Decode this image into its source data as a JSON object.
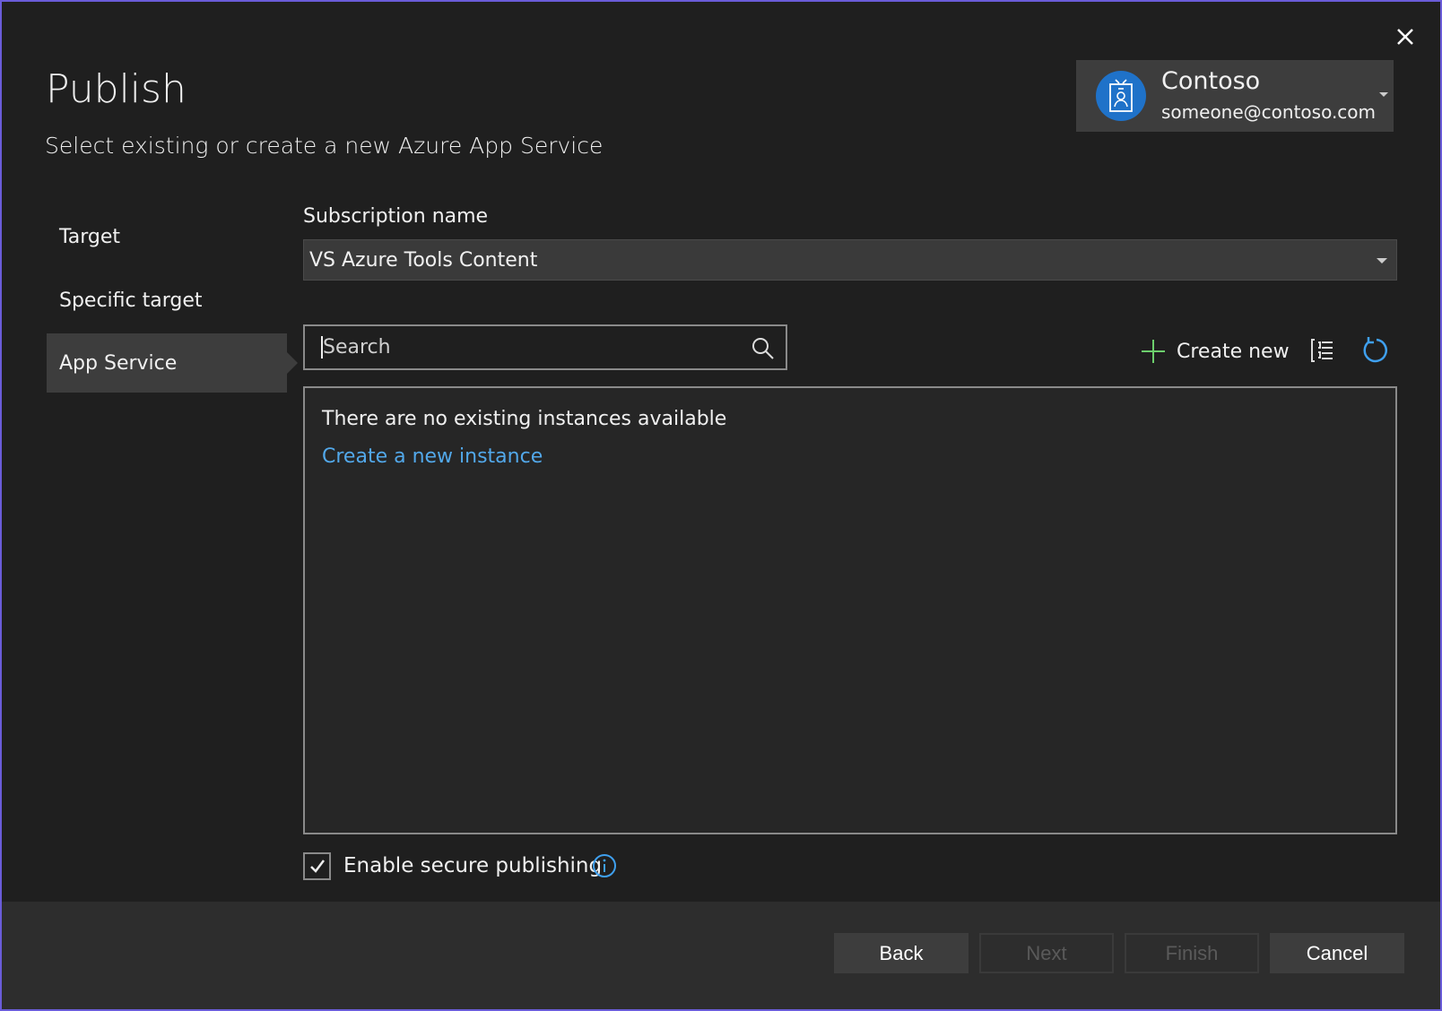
{
  "dialog": {
    "title": "Publish",
    "subtitle": "Select existing or create a new Azure App Service"
  },
  "account": {
    "name": "Contoso",
    "email": "someone@contoso.com"
  },
  "sidebar": {
    "items": [
      {
        "label": "Target"
      },
      {
        "label": "Specific target"
      },
      {
        "label": "App Service",
        "selected": true
      }
    ]
  },
  "subscription": {
    "label": "Subscription name",
    "value": "VS Azure Tools Content"
  },
  "search": {
    "placeholder": "Search"
  },
  "toolbar": {
    "create_new": "Create new"
  },
  "list": {
    "empty_text": "There are no existing instances available",
    "create_link": "Create a new instance"
  },
  "secure": {
    "label": "Enable secure publishing",
    "checked": true
  },
  "footer": {
    "back": "Back",
    "next": "Next",
    "finish": "Finish",
    "cancel": "Cancel"
  },
  "colors": {
    "accent": "#1f72c9",
    "link": "#52a8ea",
    "plus": "#6ccf6c",
    "frame": "#6a5cd8"
  }
}
